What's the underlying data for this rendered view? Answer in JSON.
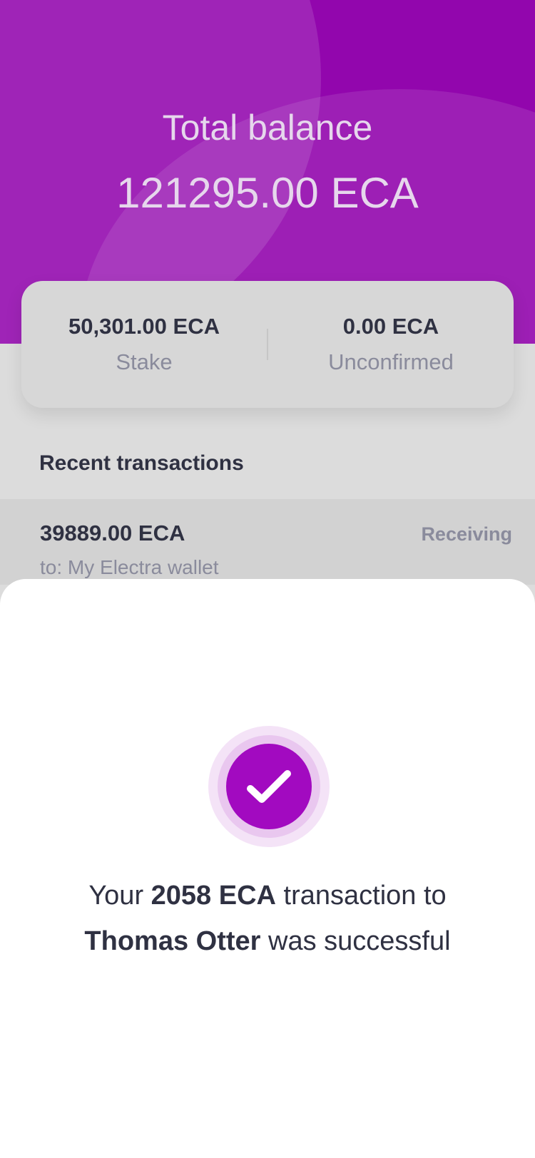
{
  "header": {
    "title": "Total balance",
    "balance": "121295.00 ECA"
  },
  "summary": {
    "stake_amount": "50,301.00 ECA",
    "stake_label": "Stake",
    "unconfirmed_amount": "0.00 ECA",
    "unconfirmed_label": "Unconfirmed"
  },
  "recent": {
    "title": "Recent transactions",
    "items": [
      {
        "amount": "39889.00 ECA",
        "to": "to: My Electra wallet",
        "status": "Receiving"
      }
    ]
  },
  "success_sheet": {
    "icon": "check-icon",
    "prefix": "Your ",
    "amount": "2058 ECA",
    "middle": " transaction to",
    "recipient": "Thomas Otter",
    "suffix": " was successful"
  },
  "colors": {
    "brand": "#9206ad",
    "accent": "#a20ac0",
    "text": "#2f3142",
    "muted": "#8a8b9c"
  }
}
